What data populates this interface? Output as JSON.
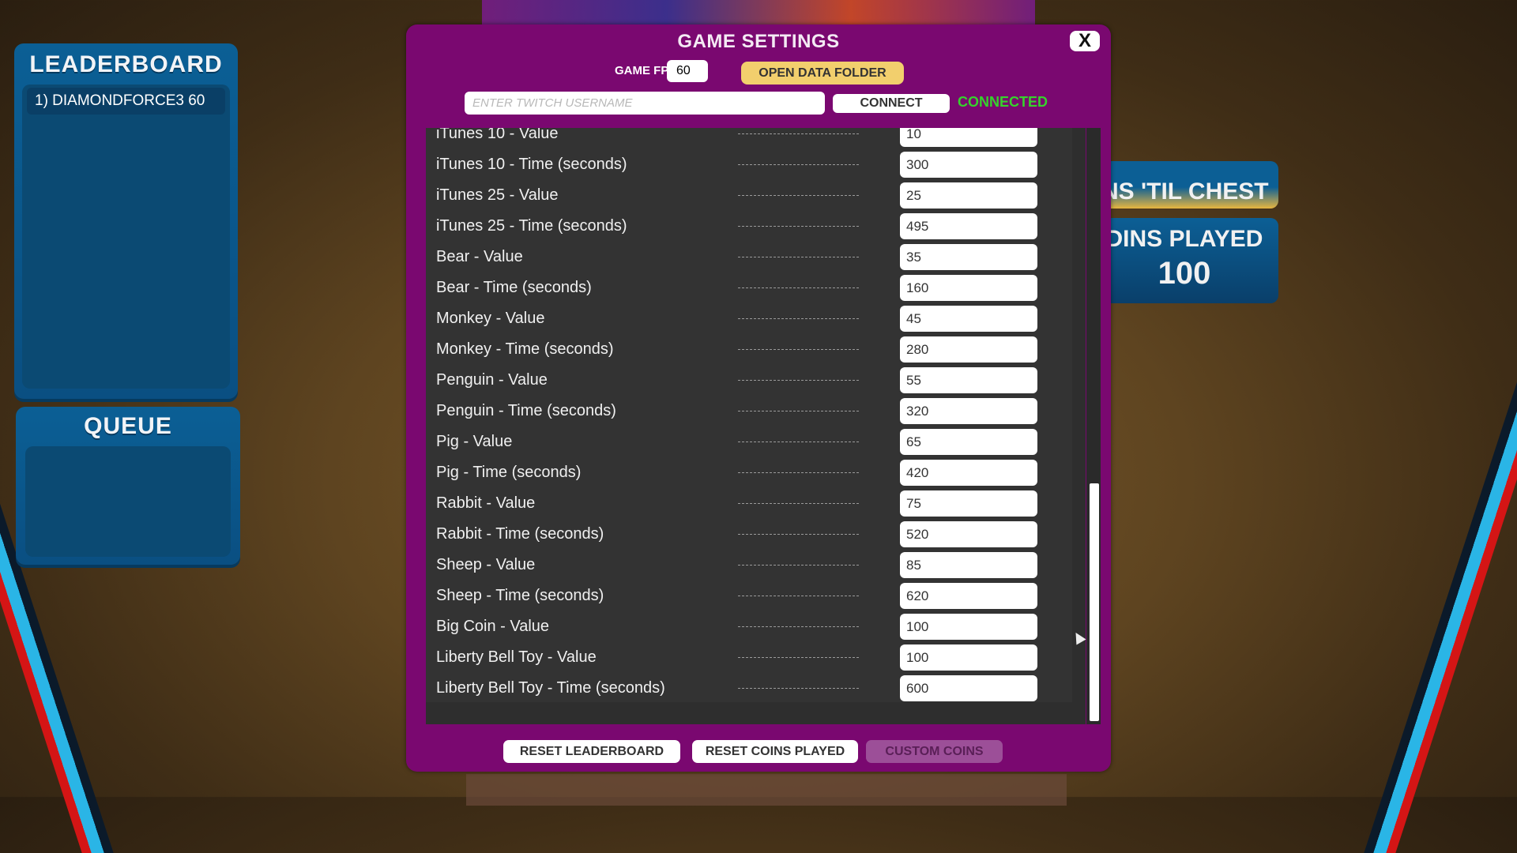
{
  "leaderboard": {
    "title": "LEADERBOARD",
    "entries": [
      "1) DIAMONDFORCE3 60"
    ]
  },
  "queue": {
    "title": "QUEUE"
  },
  "right_panel": {
    "chest_text": "NS 'TIL CHEST",
    "coins_played_label": "DINS PLAYED",
    "coins_played_value": "100"
  },
  "dialog": {
    "title": "GAME SETTINGS",
    "close_label": "X",
    "fps_label": "GAME FPS",
    "fps_value": "60",
    "open_folder_label": "OPEN DATA FOLDER",
    "twitch_placeholder": "ENTER TWITCH USERNAME",
    "connect_label": "CONNECT",
    "connection_status": "CONNECTED",
    "settings": [
      {
        "label": "iTunes 10 - Value",
        "value": "10"
      },
      {
        "label": "iTunes 10 - Time (seconds)",
        "value": "300"
      },
      {
        "label": "iTunes 25 - Value",
        "value": "25"
      },
      {
        "label": "iTunes 25 - Time (seconds)",
        "value": "495"
      },
      {
        "label": "Bear - Value",
        "value": "35"
      },
      {
        "label": "Bear - Time (seconds)",
        "value": "160"
      },
      {
        "label": "Monkey - Value",
        "value": "45"
      },
      {
        "label": "Monkey - Time (seconds)",
        "value": "280"
      },
      {
        "label": "Penguin - Value",
        "value": "55"
      },
      {
        "label": "Penguin - Time (seconds)",
        "value": "320"
      },
      {
        "label": "Pig - Value",
        "value": "65"
      },
      {
        "label": "Pig - Time (seconds)",
        "value": "420"
      },
      {
        "label": "Rabbit - Value",
        "value": "75"
      },
      {
        "label": "Rabbit - Time (seconds)",
        "value": "520"
      },
      {
        "label": "Sheep - Value",
        "value": "85"
      },
      {
        "label": "Sheep - Time (seconds)",
        "value": "620"
      },
      {
        "label": "Big Coin - Value",
        "value": "100"
      },
      {
        "label": "Liberty Bell Toy - Value",
        "value": "100"
      },
      {
        "label": "Liberty Bell Toy - Time (seconds)",
        "value": "600"
      }
    ],
    "footer": {
      "reset_leaderboard": "RESET LEADERBOARD",
      "reset_coins_played": "RESET COINS PLAYED",
      "custom_coins": "CUSTOM COINS"
    }
  },
  "colors": {
    "dialog_bg": "#7a0870",
    "connected": "#36d22c",
    "open_folder": "#f2cf6d",
    "panel_blue": "#0b5f95"
  }
}
